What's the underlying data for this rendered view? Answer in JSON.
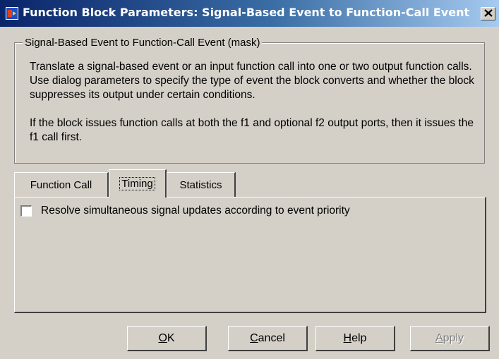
{
  "window": {
    "title": "Function Block Parameters: Signal-Based Event to Function-Call Event",
    "icon": "simulink-block-icon",
    "close_icon": "close-icon"
  },
  "group": {
    "title": "Signal-Based Event to Function-Call Event (mask)",
    "paragraphs": [
      "Translate a signal-based event or an input function call into one or two output function calls. Use dialog parameters to specify the type of event the block converts and whether the block suppresses its output under certain conditions.",
      "If the block issues function calls at both the f1 and optional f2 output ports, then it issues the f1 call first."
    ]
  },
  "tabs": [
    {
      "label": "Function Call",
      "active": false
    },
    {
      "label": "Timing",
      "active": true
    },
    {
      "label": "Statistics",
      "active": false
    }
  ],
  "timing": {
    "resolve_label": "Resolve simultaneous signal updates according to event priority",
    "resolve_checked": false
  },
  "buttons": {
    "ok": {
      "accel": "O",
      "rest": "K"
    },
    "cancel": {
      "accel": "C",
      "rest": "ancel"
    },
    "help": {
      "accel": "H",
      "rest": "elp"
    },
    "apply": {
      "accel": "A",
      "rest": "pply",
      "disabled": true
    }
  }
}
